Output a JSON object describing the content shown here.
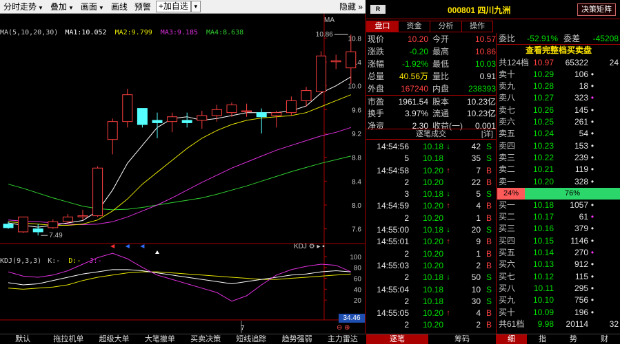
{
  "toolbar": {
    "items": [
      "分时走势",
      "叠加",
      "画面",
      "画线",
      "预警"
    ],
    "add_label": "+加自选",
    "hide_label": "隐藏"
  },
  "ma_legend": {
    "prefix": "MA(5,10,20,30)",
    "ma1": "MA1:10.052",
    "ma2": "MA2:9.799",
    "ma3": "MA3:9.185",
    "ma4": "MA4:8.638",
    "right_label": "MA"
  },
  "kdj_legend": {
    "prefix": "KDJ(9,3,3)",
    "k": "K:-",
    "d": "D:-",
    "j": "J:-",
    "right_label": "KDJ"
  },
  "price_axis": [
    "10.8",
    "10.4",
    "10.0",
    "9.6",
    "9.2",
    "8.8",
    "8.4",
    "8.0",
    "7.6"
  ],
  "kdj_axis": [
    "100",
    "80",
    "60",
    "40",
    "20"
  ],
  "chart_labels": {
    "high": "10.86",
    "low": "7.49",
    "cursor_value": "34.46",
    "date_marker": "7",
    "zoom_minus": "─",
    "zoom_plus": "➕"
  },
  "chart_data": {
    "type": "candlestick",
    "ylim": [
      7.4,
      11.0
    ],
    "kdj_ylim": [
      0,
      110
    ],
    "candles": [
      {
        "o": 7.68,
        "h": 7.72,
        "l": 7.6,
        "c": 7.62
      },
      {
        "o": 7.55,
        "h": 7.8,
        "l": 7.53,
        "c": 7.8
      },
      {
        "o": 7.6,
        "h": 7.68,
        "l": 7.49,
        "c": 7.55
      },
      {
        "o": 7.62,
        "h": 7.76,
        "l": 7.6,
        "c": 7.72
      },
      {
        "o": 7.72,
        "h": 7.85,
        "l": 7.68,
        "c": 7.8
      },
      {
        "o": 7.82,
        "h": 7.92,
        "l": 7.75,
        "c": 7.82
      },
      {
        "o": 7.82,
        "h": 8.65,
        "l": 7.8,
        "c": 8.62
      },
      {
        "o": 9.1,
        "h": 9.45,
        "l": 8.85,
        "c": 9.4
      },
      {
        "o": 9.4,
        "h": 9.95,
        "l": 9.3,
        "c": 9.85
      },
      {
        "o": 9.62,
        "h": 9.62,
        "l": 9.3,
        "c": 9.35
      },
      {
        "o": 9.42,
        "h": 9.55,
        "l": 9.12,
        "c": 9.38
      },
      {
        "o": 9.4,
        "h": 9.55,
        "l": 9.22,
        "c": 9.48
      },
      {
        "o": 9.42,
        "h": 9.55,
        "l": 9.3,
        "c": 9.38
      },
      {
        "o": 9.42,
        "h": 9.58,
        "l": 9.28,
        "c": 9.5
      },
      {
        "o": 9.5,
        "h": 9.68,
        "l": 9.4,
        "c": 9.6
      },
      {
        "o": 9.55,
        "h": 9.72,
        "l": 9.48,
        "c": 9.68
      },
      {
        "o": 9.58,
        "h": 9.7,
        "l": 9.48,
        "c": 9.58
      },
      {
        "o": 9.55,
        "h": 9.62,
        "l": 9.2,
        "c": 9.48
      },
      {
        "o": 9.5,
        "h": 9.58,
        "l": 9.3,
        "c": 9.55
      },
      {
        "o": 9.55,
        "h": 9.82,
        "l": 9.5,
        "c": 9.75
      },
      {
        "o": 9.75,
        "h": 9.98,
        "l": 9.65,
        "c": 9.92
      },
      {
        "o": 9.9,
        "h": 10.58,
        "l": 9.85,
        "c": 10.5
      },
      {
        "o": 10.42,
        "h": 10.52,
        "l": 10.28,
        "c": 10.42
      },
      {
        "o": 10.3,
        "h": 10.86,
        "l": 10.03,
        "c": 10.57
      }
    ],
    "ma5": [
      7.7,
      7.66,
      7.63,
      7.66,
      7.7,
      7.74,
      7.9,
      8.25,
      8.7,
      9.0,
      9.3,
      9.45,
      9.48,
      9.42,
      9.45,
      9.5,
      9.55,
      9.55,
      9.55,
      9.58,
      9.66,
      9.88,
      10.0,
      10.15
    ],
    "ma10": [
      7.72,
      7.7,
      7.68,
      7.66,
      7.66,
      7.68,
      7.75,
      7.9,
      8.1,
      8.35,
      8.55,
      8.75,
      8.95,
      9.12,
      9.25,
      9.35,
      9.42,
      9.46,
      9.48,
      9.5,
      9.55,
      9.65,
      9.75,
      9.85
    ],
    "ma20": [
      7.75,
      7.73,
      7.72,
      7.7,
      7.68,
      7.67,
      7.68,
      7.72,
      7.8,
      7.9,
      8.0,
      8.12,
      8.25,
      8.38,
      8.5,
      8.62,
      8.72,
      8.82,
      8.92,
      9.0,
      9.08,
      9.16,
      9.22,
      9.3
    ],
    "ma30": [
      8.35,
      8.28,
      8.2,
      8.12,
      8.05,
      7.98,
      7.94,
      7.92,
      7.93,
      7.96,
      8.0,
      8.04,
      8.08,
      8.12,
      8.18,
      8.25,
      8.32,
      8.4,
      8.48,
      8.56,
      8.63,
      8.7,
      8.76,
      8.82
    ],
    "kdj_k": [
      52,
      48,
      50,
      56,
      62,
      68,
      72,
      76,
      76,
      74,
      70,
      66,
      62,
      58,
      54,
      50,
      54,
      58,
      62,
      66,
      68,
      72,
      74,
      72
    ],
    "kdj_d": [
      42,
      40,
      42,
      44,
      48,
      56,
      62,
      66,
      70,
      72,
      72,
      70,
      68,
      66,
      64,
      62,
      60,
      58,
      58,
      60,
      62,
      64,
      66,
      68
    ],
    "kdj_j": [
      72,
      64,
      62,
      66,
      74,
      86,
      98,
      106,
      96,
      80,
      66,
      58,
      50,
      42,
      34,
      18,
      28,
      48,
      66,
      76,
      82,
      86,
      84,
      72
    ]
  },
  "bottom_tabs": [
    "默认",
    "拖拉机单",
    "超级大单",
    "大笔撤单",
    "买卖决策",
    "短线追踪",
    "趋势强弱",
    "主力雷达"
  ],
  "stock": {
    "badge": "R",
    "title": "000801 四川九洲",
    "decide_button": "决策矩阵"
  },
  "right_tabs": [
    "盘口",
    "资金",
    "分析",
    "操作"
  ],
  "quote": {
    "rows": [
      {
        "l1": "现价",
        "v1": "10.20",
        "c1": "red",
        "l2": "今开",
        "v2": "10.57",
        "c2": "red"
      },
      {
        "l1": "涨跌",
        "v1": "-0.20",
        "c1": "green",
        "l2": "最高",
        "v2": "10.86",
        "c2": "red"
      },
      {
        "l1": "涨幅",
        "v1": "-1.92%",
        "c1": "green",
        "l2": "最低",
        "v2": "10.03",
        "c2": "green"
      },
      {
        "l1": "总量",
        "v1": "40.56万",
        "c1": "yellow",
        "l2": "量比",
        "v2": "0.91",
        "c2": "white"
      },
      {
        "l1": "外盘",
        "v1": "167240",
        "c1": "red",
        "l2": "内盘",
        "v2": "238393",
        "c2": "green"
      },
      {
        "l1": "市盈",
        "v1": "1961.54",
        "c1": "white",
        "l2": "股本",
        "v2": "10.23亿",
        "c2": "white"
      },
      {
        "l1": "换手",
        "v1": "3.97%",
        "c1": "white",
        "l2": "流通",
        "v2": "10.23亿",
        "c2": "white"
      },
      {
        "l1": "净资",
        "v1": "2.30",
        "c1": "white",
        "l2": "收益(一)",
        "v2": "0.001",
        "c2": "white"
      }
    ]
  },
  "trades_header": "逐笔成交",
  "trades_detail": "[详]",
  "trades": [
    {
      "t": "14:54:56",
      "p": "10.18",
      "pc": "green",
      "a": "↓",
      "ac": "green",
      "v": "42",
      "s": "S",
      "sc": "green"
    },
    {
      "t": "5",
      "p": "10.18",
      "pc": "green",
      "a": "",
      "ac": "green",
      "v": "35",
      "s": "S",
      "sc": "green"
    },
    {
      "t": "14:54:58",
      "p": "10.20",
      "pc": "green",
      "a": "↑",
      "ac": "red",
      "v": "7",
      "s": "B",
      "sc": "red"
    },
    {
      "t": "2",
      "p": "10.20",
      "pc": "green",
      "a": "",
      "ac": "red",
      "v": "22",
      "s": "B",
      "sc": "red"
    },
    {
      "t": "3",
      "p": "10.18",
      "pc": "green",
      "a": "↓",
      "ac": "green",
      "v": "5",
      "s": "S",
      "sc": "green"
    },
    {
      "t": "14:54:59",
      "p": "10.20",
      "pc": "green",
      "a": "↑",
      "ac": "red",
      "v": "4",
      "s": "B",
      "sc": "red"
    },
    {
      "t": "2",
      "p": "10.20",
      "pc": "green",
      "a": "",
      "ac": "red",
      "v": "1",
      "s": "B",
      "sc": "red"
    },
    {
      "t": "14:55:00",
      "p": "10.18",
      "pc": "green",
      "a": "↓",
      "ac": "green",
      "v": "20",
      "s": "S",
      "sc": "green"
    },
    {
      "t": "14:55:01",
      "p": "10.20",
      "pc": "green",
      "a": "↑",
      "ac": "red",
      "v": "9",
      "s": "B",
      "sc": "red"
    },
    {
      "t": "2",
      "p": "10.20",
      "pc": "green",
      "a": "",
      "ac": "red",
      "v": "1",
      "s": "B",
      "sc": "red"
    },
    {
      "t": "14:55:03",
      "p": "10.20",
      "pc": "green",
      "a": "",
      "ac": "red",
      "v": "2",
      "s": "B",
      "sc": "red"
    },
    {
      "t": "2",
      "p": "10.18",
      "pc": "green",
      "a": "↓",
      "ac": "green",
      "v": "50",
      "s": "S",
      "sc": "green"
    },
    {
      "t": "14:55:04",
      "p": "10.18",
      "pc": "green",
      "a": "",
      "ac": "green",
      "v": "10",
      "s": "S",
      "sc": "green"
    },
    {
      "t": "2",
      "p": "10.18",
      "pc": "green",
      "a": "",
      "ac": "green",
      "v": "30",
      "s": "S",
      "sc": "green"
    },
    {
      "t": "14:55:05",
      "p": "10.20",
      "pc": "green",
      "a": "↑",
      "ac": "red",
      "v": "4",
      "s": "B",
      "sc": "red"
    },
    {
      "t": "2",
      "p": "10.20",
      "pc": "green",
      "a": "",
      "ac": "red",
      "v": "2",
      "s": "B",
      "sc": "red"
    }
  ],
  "book": {
    "wb_label": "委比",
    "wb_value": "-52.91%",
    "wc_label": "委差",
    "wc_value": "-45208",
    "title": "查看完整档买卖盘",
    "sell_total_label": "共124档",
    "sell_total_price": "10.97",
    "sell_total_vol": "65322",
    "sell_total_extra": "24",
    "sells": [
      {
        "l": "卖十",
        "p": "10.29",
        "v": "106",
        "m": "•",
        "mc": "white"
      },
      {
        "l": "卖九",
        "p": "10.28",
        "v": "18",
        "m": "•",
        "mc": "white"
      },
      {
        "l": "卖八",
        "p": "10.27",
        "v": "323",
        "m": "•",
        "mc": "magenta"
      },
      {
        "l": "卖七",
        "p": "10.26",
        "v": "145",
        "m": "•",
        "mc": "white"
      },
      {
        "l": "卖六",
        "p": "10.25",
        "v": "261",
        "m": "•",
        "mc": "white"
      },
      {
        "l": "卖五",
        "p": "10.24",
        "v": "54",
        "m": "•",
        "mc": "white"
      },
      {
        "l": "卖四",
        "p": "10.23",
        "v": "153",
        "m": "•",
        "mc": "white"
      },
      {
        "l": "卖三",
        "p": "10.22",
        "v": "239",
        "m": "•",
        "mc": "white"
      },
      {
        "l": "卖二",
        "p": "10.21",
        "v": "119",
        "m": "•",
        "mc": "white"
      },
      {
        "l": "卖一",
        "p": "10.20",
        "v": "328",
        "m": "•",
        "mc": "white"
      }
    ],
    "ratio_left": "24%",
    "ratio_right": "76%",
    "buys": [
      {
        "l": "买一",
        "p": "10.18",
        "v": "1057",
        "m": "•",
        "mc": "white"
      },
      {
        "l": "买二",
        "p": "10.17",
        "v": "61",
        "m": "•",
        "mc": "magenta"
      },
      {
        "l": "买三",
        "p": "10.16",
        "v": "379",
        "m": "•",
        "mc": "white"
      },
      {
        "l": "买四",
        "p": "10.15",
        "v": "1146",
        "m": "•",
        "mc": "white"
      },
      {
        "l": "买五",
        "p": "10.14",
        "v": "270",
        "m": "•",
        "mc": "magenta"
      },
      {
        "l": "买六",
        "p": "10.13",
        "v": "912",
        "m": "•",
        "mc": "white"
      },
      {
        "l": "买七",
        "p": "10.12",
        "v": "115",
        "m": "•",
        "mc": "white"
      },
      {
        "l": "买八",
        "p": "10.11",
        "v": "295",
        "m": "•",
        "mc": "white"
      },
      {
        "l": "买九",
        "p": "10.10",
        "v": "756",
        "m": "•",
        "mc": "white"
      },
      {
        "l": "买十",
        "p": "10.09",
        "v": "196",
        "m": "•",
        "mc": "white"
      }
    ],
    "buy_total_label": "共61档",
    "buy_total_price": "9.98",
    "buy_total_vol": "20114",
    "buy_total_extra": "32"
  },
  "right_bottom_tabs": [
    "逐笔",
    "筹码",
    "细",
    "指",
    "势",
    "财"
  ],
  "colors": {
    "up": "#ff4040",
    "down": "#00e000",
    "ma1": "#ffffff",
    "ma2": "#e6e600",
    "ma3": "#e030e0",
    "ma4": "#30d030",
    "panel_border": "#aa0000"
  }
}
